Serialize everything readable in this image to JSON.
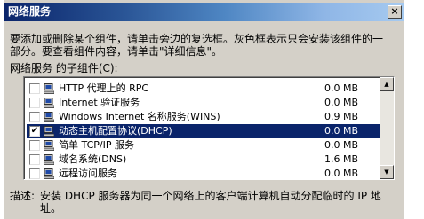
{
  "window": {
    "title": "网络服务",
    "close_glyph": "×"
  },
  "instructions": {
    "line1": "要添加或删除某个组件，请单击旁边的复选框。灰色框表示只会安装该组件的一",
    "line2": "部分。要查看组件内容，请单击\"详细信息\"。"
  },
  "list_label": "网络服务 的子组件(C):",
  "components": [
    {
      "checked": false,
      "selected": false,
      "name": "HTTP 代理上的 RPC",
      "size": "0.0 MB"
    },
    {
      "checked": false,
      "selected": false,
      "name": "Internet 验证服务",
      "size": "0.0 MB"
    },
    {
      "checked": false,
      "selected": false,
      "name": "Windows Internet 名称服务(WINS)",
      "size": "0.9 MB"
    },
    {
      "checked": true,
      "selected": true,
      "name": "动态主机配置协议(DHCP)",
      "size": "0.0 MB"
    },
    {
      "checked": false,
      "selected": false,
      "name": "简单 TCP/IP 服务",
      "size": "0.0 MB"
    },
    {
      "checked": false,
      "selected": false,
      "name": "域名系统(DNS)",
      "size": "1.6 MB"
    },
    {
      "checked": false,
      "selected": false,
      "name": "远程访问服务",
      "size": "0.0 MB"
    }
  ],
  "scrollbar": {
    "up": "▲",
    "down": "▼"
  },
  "description": {
    "label": "描述:",
    "text": "安装 DHCP 服务器为同一个网络上的客户端计算机自动分配临时的 IP 地址。"
  }
}
